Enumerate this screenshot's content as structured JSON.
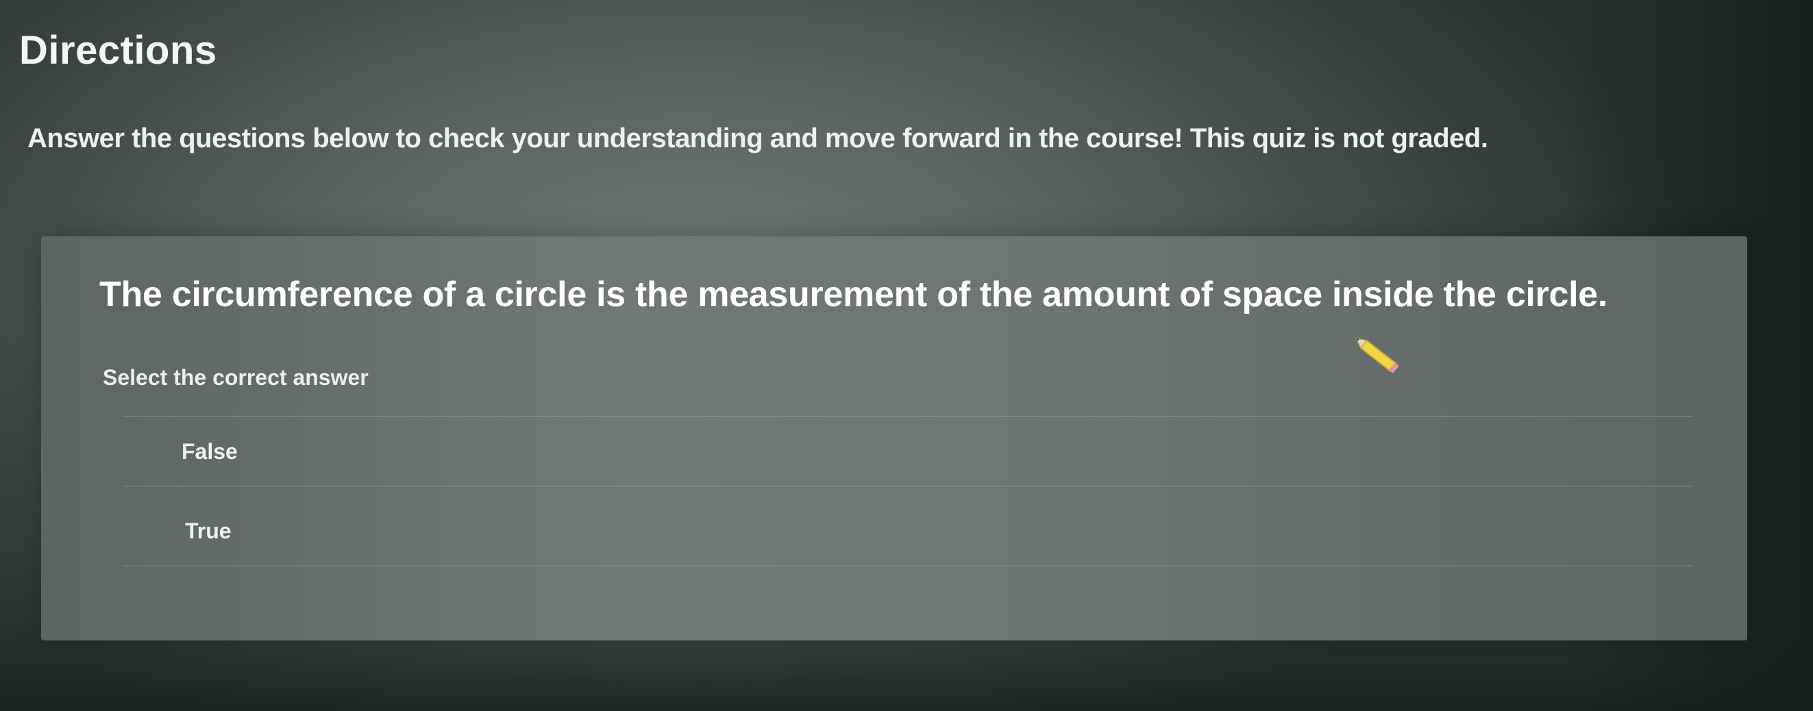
{
  "directions": {
    "title": "Directions",
    "body": "Answer the questions below to check your understanding and move forward in the course! This quiz is not graded."
  },
  "question": {
    "text": "The circumference of a circle is the measurement of the amount of space inside the circle.",
    "prompt": "Select the correct answer",
    "options": [
      {
        "label": "False"
      },
      {
        "label": "True"
      }
    ]
  },
  "cursor": {
    "icon": "pencil-cursor-icon",
    "color": "#f2d648"
  }
}
